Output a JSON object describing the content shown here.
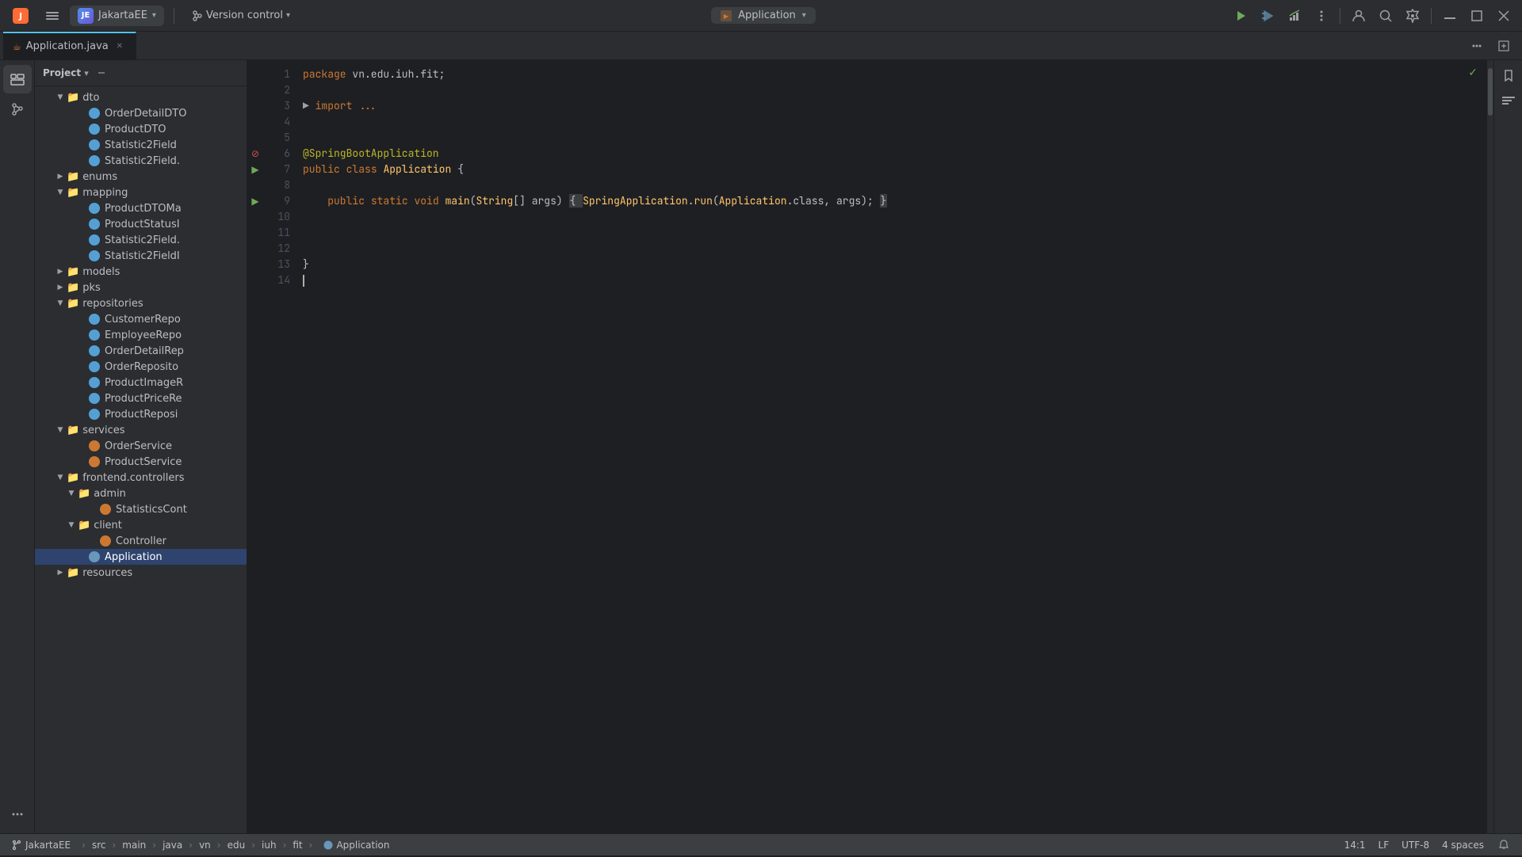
{
  "app": {
    "title": "JakartaEE",
    "project_name": "JakartaEE",
    "version_control": "Version control",
    "run_config": "Application"
  },
  "tabs": [
    {
      "name": "Application.java",
      "active": true,
      "icon": "java"
    }
  ],
  "file_tree": {
    "panel_title": "Project",
    "items": [
      {
        "id": "dto",
        "label": "dto",
        "type": "folder",
        "indent": 1,
        "open": true
      },
      {
        "id": "OrderDetailDTO",
        "label": "OrderDetailDTO",
        "type": "interface",
        "indent": 3
      },
      {
        "id": "ProductDTO",
        "label": "ProductDTO",
        "type": "interface",
        "indent": 3
      },
      {
        "id": "Statistic2Field",
        "label": "Statistic2Field",
        "type": "interface",
        "indent": 3
      },
      {
        "id": "Statistic2Field2",
        "label": "Statistic2Field.",
        "type": "interface",
        "indent": 3
      },
      {
        "id": "enums",
        "label": "enums",
        "type": "folder",
        "indent": 1,
        "open": false
      },
      {
        "id": "mapping",
        "label": "mapping",
        "type": "folder",
        "indent": 1,
        "open": true
      },
      {
        "id": "ProductDTOMa",
        "label": "ProductDTOMa",
        "type": "interface",
        "indent": 3
      },
      {
        "id": "ProductStatusI",
        "label": "ProductStatusI",
        "type": "interface",
        "indent": 3
      },
      {
        "id": "Statistic2Field3",
        "label": "Statistic2Field.",
        "type": "interface",
        "indent": 3
      },
      {
        "id": "Statistic2FieldI",
        "label": "Statistic2FieldI",
        "type": "interface",
        "indent": 3
      },
      {
        "id": "models",
        "label": "models",
        "type": "folder",
        "indent": 1,
        "open": false
      },
      {
        "id": "pks",
        "label": "pks",
        "type": "folder",
        "indent": 1,
        "open": false
      },
      {
        "id": "repositories",
        "label": "repositories",
        "type": "folder",
        "indent": 1,
        "open": true
      },
      {
        "id": "CustomerRepo",
        "label": "CustomerRepo",
        "type": "interface",
        "indent": 3
      },
      {
        "id": "EmployeeRepo",
        "label": "EmployeeRepo",
        "type": "interface",
        "indent": 3
      },
      {
        "id": "OrderDetailRep",
        "label": "OrderDetailRep",
        "type": "interface",
        "indent": 3
      },
      {
        "id": "OrderReposito",
        "label": "OrderReposito",
        "type": "interface",
        "indent": 3
      },
      {
        "id": "ProductImageR",
        "label": "ProductImageR",
        "type": "interface",
        "indent": 3
      },
      {
        "id": "ProductPriceRe",
        "label": "ProductPriceRe",
        "type": "interface",
        "indent": 3
      },
      {
        "id": "ProductReposi",
        "label": "ProductReposi",
        "type": "interface",
        "indent": 3
      },
      {
        "id": "services",
        "label": "services",
        "type": "folder",
        "indent": 1,
        "open": true
      },
      {
        "id": "OrderService",
        "label": "OrderService",
        "type": "class",
        "indent": 3
      },
      {
        "id": "ProductService",
        "label": "ProductService",
        "type": "class",
        "indent": 3
      },
      {
        "id": "frontend.controllers",
        "label": "frontend.controllers",
        "type": "folder",
        "indent": 1,
        "open": true
      },
      {
        "id": "admin",
        "label": "admin",
        "type": "folder",
        "indent": 2,
        "open": true
      },
      {
        "id": "StatisticsCont",
        "label": "StatisticsCont",
        "type": "class",
        "indent": 4
      },
      {
        "id": "client",
        "label": "client",
        "type": "folder",
        "indent": 2,
        "open": true
      },
      {
        "id": "Controller",
        "label": "Controller",
        "type": "class",
        "indent": 4
      },
      {
        "id": "Application",
        "label": "Application",
        "type": "app",
        "indent": 3,
        "selected": true
      },
      {
        "id": "resources",
        "label": "resources",
        "type": "folder",
        "indent": 1,
        "open": false
      }
    ]
  },
  "code": {
    "filename": "Application.java",
    "lines": [
      {
        "num": 1,
        "content": "package vn.edu.iuh.fit;",
        "tokens": [
          {
            "t": "kw",
            "v": "package"
          },
          {
            "t": "plain",
            "v": " vn.edu.iuh.fit;"
          }
        ]
      },
      {
        "num": 2,
        "content": "",
        "tokens": []
      },
      {
        "num": 3,
        "content": "  import ...",
        "tokens": [
          {
            "t": "plain",
            "v": "  "
          },
          {
            "t": "kw",
            "v": "import"
          },
          {
            "t": "import-dots",
            "v": " ..."
          }
        ]
      },
      {
        "num": 4,
        "content": "",
        "tokens": []
      },
      {
        "num": 5,
        "content": "",
        "tokens": []
      },
      {
        "num": 6,
        "content": "@SpringBootApplication",
        "tokens": [
          {
            "t": "annotation",
            "v": "@SpringBootApplication"
          }
        ]
      },
      {
        "num": 7,
        "content": "public class Application {",
        "tokens": [
          {
            "t": "kw",
            "v": "public"
          },
          {
            "t": "plain",
            "v": " "
          },
          {
            "t": "kw",
            "v": "class"
          },
          {
            "t": "plain",
            "v": " "
          },
          {
            "t": "classname",
            "v": "Application"
          },
          {
            "t": "plain",
            "v": " {"
          }
        ]
      },
      {
        "num": 8,
        "content": "",
        "tokens": []
      },
      {
        "num": 9,
        "content": "    public static void main(String[] args) { SpringApplication.run(Application.class, args); }",
        "tokens": [
          {
            "t": "plain",
            "v": "    "
          },
          {
            "t": "kw",
            "v": "public"
          },
          {
            "t": "plain",
            "v": " "
          },
          {
            "t": "kw",
            "v": "static"
          },
          {
            "t": "plain",
            "v": " "
          },
          {
            "t": "kw",
            "v": "void"
          },
          {
            "t": "plain",
            "v": " "
          },
          {
            "t": "method",
            "v": "main"
          },
          {
            "t": "plain",
            "v": "("
          },
          {
            "t": "classname",
            "v": "String"
          },
          {
            "t": "plain",
            "v": "[] args) "
          },
          {
            "t": "brace",
            "v": "{ "
          },
          {
            "t": "classname",
            "v": "SpringApplication"
          },
          {
            "t": "plain",
            "v": "."
          },
          {
            "t": "method",
            "v": "run"
          },
          {
            "t": "plain",
            "v": "("
          },
          {
            "t": "classname",
            "v": "Application"
          },
          {
            "t": "plain",
            "v": ".class, args); }"
          }
        ]
      },
      {
        "num": 10,
        "content": "",
        "tokens": []
      },
      {
        "num": 11,
        "content": "",
        "tokens": []
      },
      {
        "num": 12,
        "content": "",
        "tokens": []
      },
      {
        "num": 13,
        "content": "}",
        "tokens": [
          {
            "t": "plain",
            "v": "}"
          }
        ]
      },
      {
        "num": 14,
        "content": "",
        "tokens": [],
        "cursor": true
      }
    ]
  },
  "status_bar": {
    "breadcrumbs": [
      "JakartaEE",
      "src",
      "main",
      "java",
      "vn",
      "edu",
      "iuh",
      "fit",
      "Application"
    ],
    "cursor_pos": "14:1",
    "line_ending": "LF",
    "encoding": "UTF-8",
    "indent": "4 spaces"
  },
  "right_panel_icons": [
    "notification-icon",
    "bookmark-icon"
  ],
  "left_icons": [
    "folder-icon",
    "commit-icon",
    "more-icon"
  ],
  "bottom_left_icons": [
    "terminal-icon",
    "git-icon",
    "run-icon",
    "debug-icon",
    "notifications-icon",
    "settings-icon"
  ]
}
